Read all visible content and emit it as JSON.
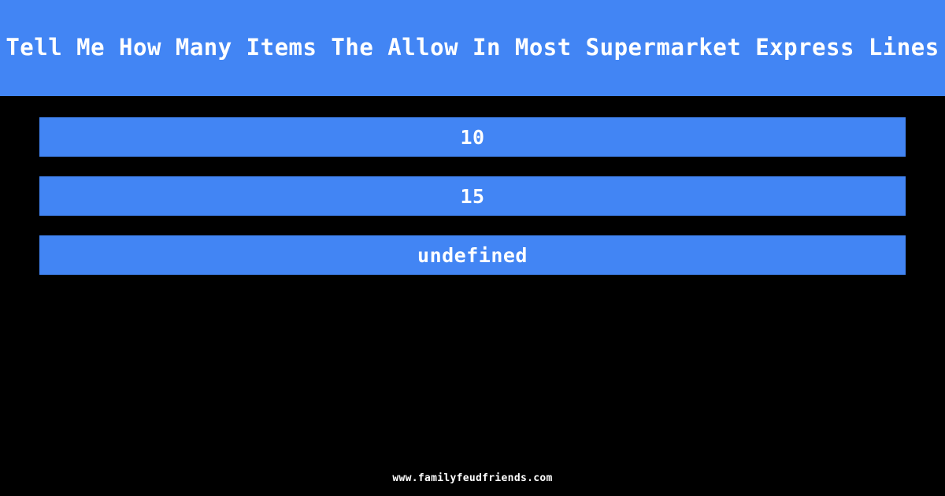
{
  "header": {
    "title": "Tell Me How Many Items The Allow In Most Supermarket Express Lines",
    "background_color": "#4285f4",
    "text_color": "#ffffff"
  },
  "theme": {
    "page_background": "#000000",
    "accent_color": "#4285f4",
    "text_color": "#ffffff"
  },
  "answers": {
    "bar_color": "#4285f4",
    "items": [
      {
        "text": "10"
      },
      {
        "text": "15"
      },
      {
        "text": "undefined"
      }
    ]
  },
  "footer": {
    "site": "www.familyfeudfriends.com"
  }
}
